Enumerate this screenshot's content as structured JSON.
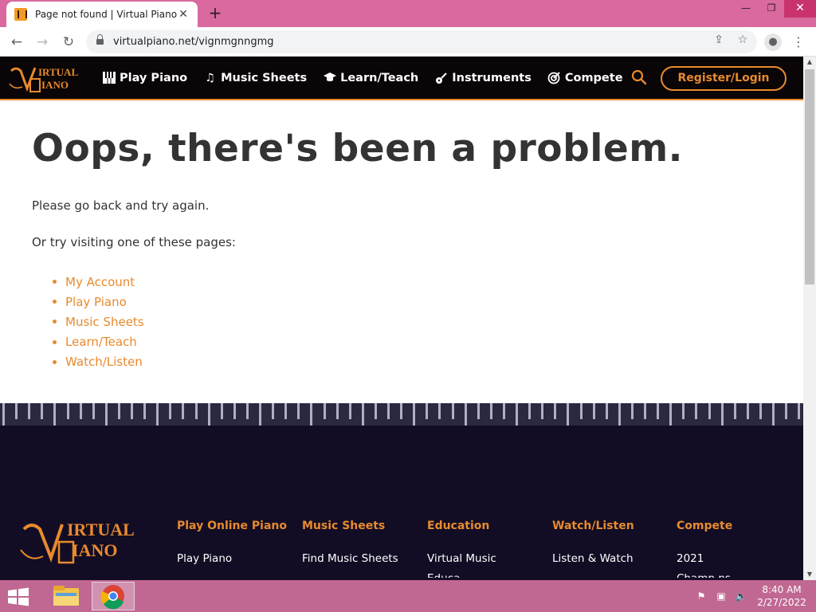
{
  "browser": {
    "tab_title": "Page not found | Virtual Piano",
    "url": "virtualpiano.net/vignmgnngmg"
  },
  "site_nav": {
    "items": [
      {
        "label": "Play Piano",
        "icon": "piano-keys-icon"
      },
      {
        "label": "Music Sheets",
        "icon": "music-note-icon"
      },
      {
        "label": "Learn/Teach",
        "icon": "graduation-cap-icon"
      },
      {
        "label": "Instruments",
        "icon": "guitar-icon"
      },
      {
        "label": "Compete",
        "icon": "target-icon"
      }
    ],
    "register_label": "Register/Login"
  },
  "error": {
    "title": "Oops, there's been a problem.",
    "message": "Please go back and try again.",
    "sub": "Or try visiting one of these pages:",
    "links": [
      "My Account",
      "Play Piano",
      "Music Sheets",
      "Learn/Teach",
      "Watch/Listen"
    ]
  },
  "footer": {
    "columns": [
      {
        "head": "Play Online Piano",
        "link": "Play Piano"
      },
      {
        "head": "Music Sheets",
        "link": "Find Music Sheets"
      },
      {
        "head": "Education",
        "link": "Virtual Music",
        "cut": "Educa"
      },
      {
        "head": "Watch/Listen",
        "link": "Listen & Watch"
      },
      {
        "head": "Compete",
        "link": "2021",
        "cut": "Champ    ns"
      }
    ]
  },
  "taskbar": {
    "time": "8:40 AM",
    "date": "2/27/2022"
  },
  "colors": {
    "accent": "#e88a2e",
    "header_bg": "#0a0506",
    "footer_bg": "#120d24",
    "tabstrip": "#d9699e"
  }
}
